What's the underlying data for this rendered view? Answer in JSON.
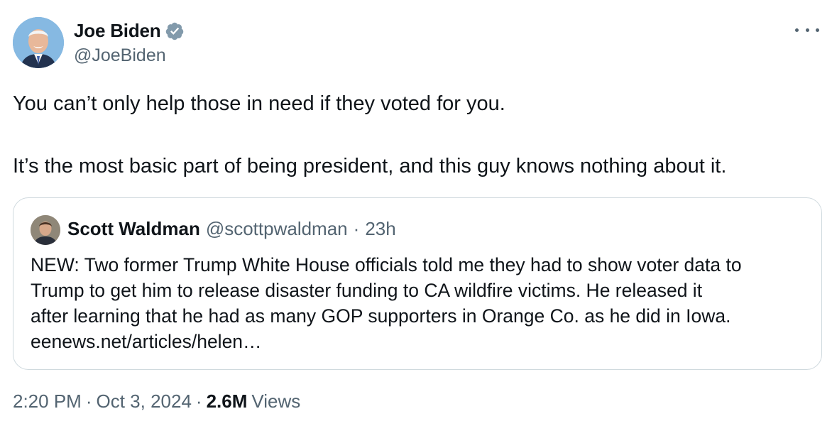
{
  "author": {
    "display_name": "Joe Biden",
    "handle": "@JoeBiden",
    "verified": true,
    "avatar_icon": "profile-photo-icon"
  },
  "tweet": {
    "paragraphs": [
      "You can’t only help those in need if they voted for you.",
      "It’s the most basic part of being president, and this guy knows nothing about it."
    ]
  },
  "quote": {
    "display_name": "Scott Waldman",
    "handle": "@scottpwaldman",
    "separator": "·",
    "time": "23h",
    "lines": [
      "NEW: Two former Trump White House officials told me they had to show voter data to",
      "Trump to get him to release disaster funding to CA wildfire victims. He released it",
      "after learning that he had as many GOP supporters in Orange Co. as he did in Iowa.",
      "eenews.net/articles/helen…"
    ]
  },
  "meta": {
    "time": "2:20 PM",
    "separator": "·",
    "date": "Oct 3, 2024",
    "views_count": "2.6M",
    "views_label": "Views"
  },
  "colors": {
    "verified_badge": "#829aab",
    "secondary_text": "#536471",
    "border": "#cfd9de"
  }
}
